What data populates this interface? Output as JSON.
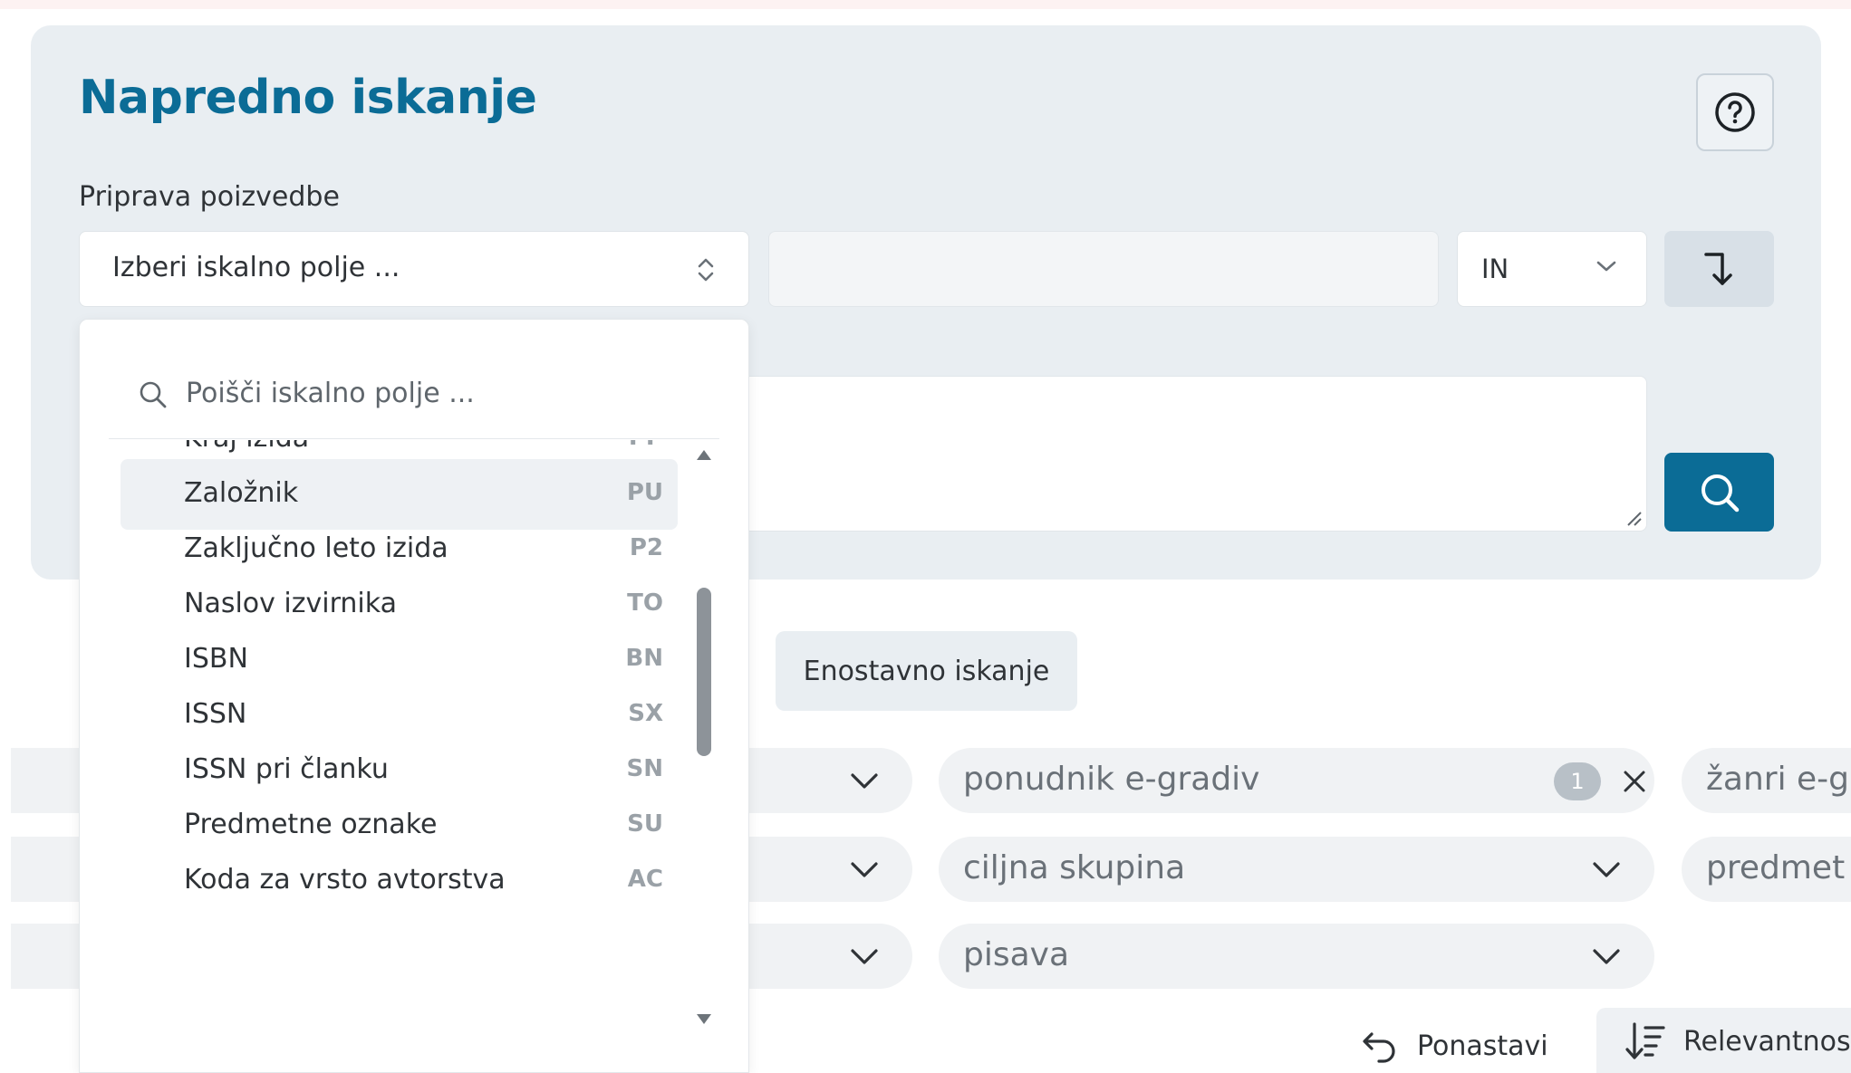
{
  "advanced_search": {
    "title": "Napredno iskanje",
    "help_icon": "question-circle-icon",
    "section_label": "Priprava poizvedbe",
    "field_select_placeholder": "Izberi iskalno polje ...",
    "operator": "IN",
    "add_icon": "arrow-down-right-icon",
    "search_icon": "search-icon"
  },
  "dropdown": {
    "search_placeholder": "Poišči iskalno polje ...",
    "items": [
      {
        "label": "Kraj izida",
        "code": "PP"
      },
      {
        "label": "Založnik",
        "code": "PU",
        "highlighted": true
      },
      {
        "label": "Zaključno leto izida",
        "code": "P2"
      },
      {
        "label": "Naslov izvirnika",
        "code": "TO"
      },
      {
        "label": "ISBN",
        "code": "BN"
      },
      {
        "label": "ISSN",
        "code": "SX"
      },
      {
        "label": "ISSN pri članku",
        "code": "SN"
      },
      {
        "label": "Predmetne oznake",
        "code": "SU"
      },
      {
        "label": "Koda za vrsto avtorstva",
        "code": "AC"
      }
    ]
  },
  "simple_search_label": "Enostavno iskanje",
  "filters": {
    "provider": {
      "label": "ponudnik e-gradiv",
      "count": "1"
    },
    "genres": {
      "label": "žanri e-gr"
    },
    "target_group": {
      "label": "ciljna skupina"
    },
    "subject": {
      "label": "predmet"
    },
    "script": {
      "label": "pisava"
    }
  },
  "actions": {
    "reset_label": "Ponastavi",
    "sort_label": "Relevantnos"
  },
  "colors": {
    "brand": "#0b6c96",
    "panel_bg": "#e9eef2"
  }
}
